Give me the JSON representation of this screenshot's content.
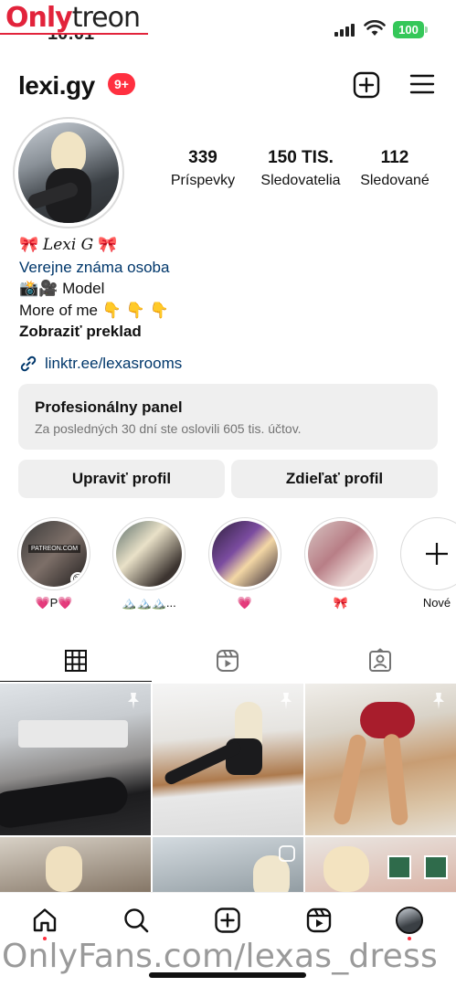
{
  "watermark": {
    "top_only": "Only",
    "top_treon": "treon",
    "bottom": "OnlyFans.com/lexas_dress"
  },
  "status_bar": {
    "time": "10:01",
    "battery": "100",
    "battery_color": "#35c759"
  },
  "header": {
    "username": "lexi.gy",
    "notification_badge": "9+",
    "badge_color": "#ff3040",
    "add_icon": "plus-square-icon",
    "menu_icon": "hamburger-menu-icon"
  },
  "stats": [
    {
      "value": "339",
      "label": "Príspevky"
    },
    {
      "value": "150 TIS.",
      "label": "Sledovatelia"
    },
    {
      "value": "112",
      "label": "Sledované"
    }
  ],
  "bio": {
    "bow": "🎀",
    "name": "Lexi G",
    "category": "Verejne známa osoba",
    "line1_emoji": "📸🎥",
    "line1_text": "Model",
    "line2_text": "More of me",
    "line2_emoji": "👇 👇 👇",
    "translate": "Zobraziť preklad",
    "link": "linktr.ee/lexasrooms",
    "link_color": "#00376b"
  },
  "pro_panel": {
    "title": "Profesionálny panel",
    "subtitle": "Za posledných 30 dní ste oslovili 605 tis. účtov."
  },
  "buttons": {
    "edit": "Upraviť profil",
    "share": "Zdieľať profil"
  },
  "highlights": [
    {
      "caption": "💗P💗",
      "tag": "PATREON.COM"
    },
    {
      "caption": "🏔️🏔️🏔️..."
    },
    {
      "caption": "💗"
    },
    {
      "caption": "🎀"
    },
    {
      "caption": "Nové"
    }
  ],
  "tabs": [
    {
      "icon": "grid-icon",
      "active": true
    },
    {
      "icon": "reels-icon",
      "active": false
    },
    {
      "icon": "tagged-icon",
      "active": false
    }
  ],
  "bottom_nav": [
    {
      "icon": "home-icon"
    },
    {
      "icon": "search-icon"
    },
    {
      "icon": "create-icon"
    },
    {
      "icon": "reels-icon"
    },
    {
      "icon": "profile-avatar-icon"
    }
  ]
}
